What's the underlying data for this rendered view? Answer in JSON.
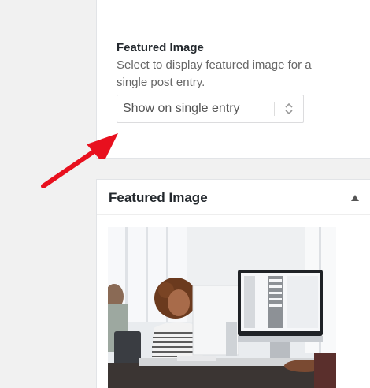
{
  "settings": {
    "title": "Featured Image",
    "description": "Select to display featured image for a single post entry.",
    "select": {
      "value": "Show on single entry",
      "icon": "updown-chevron-icon"
    }
  },
  "annotation": {
    "arrow_color": "#e8101e"
  },
  "featured_box": {
    "title": "Featured Image",
    "toggle_icon": "triangle-up-icon",
    "image": "woman-at-desk-with-computer-photo"
  }
}
